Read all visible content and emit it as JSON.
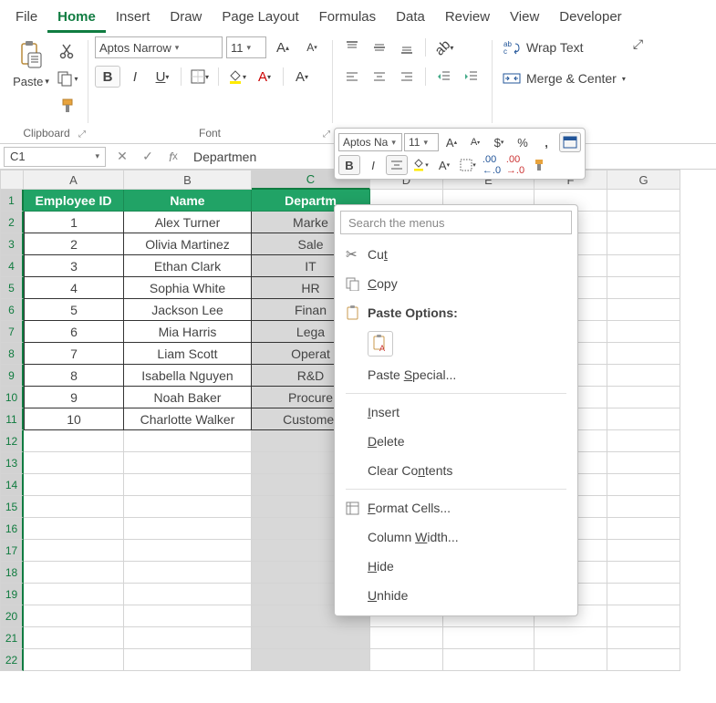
{
  "menus": [
    "File",
    "Home",
    "Insert",
    "Draw",
    "Page Layout",
    "Formulas",
    "Data",
    "Review",
    "View",
    "Developer"
  ],
  "active_menu": "Home",
  "ribbon": {
    "clipboard_label": "Clipboard",
    "paste_label": "Paste",
    "font_label": "Font",
    "font_name": "Aptos Narrow",
    "font_size": "11",
    "wrap_label": "Wrap Text",
    "merge_label": "Merge & Center"
  },
  "mini": {
    "font_name": "Aptos Na",
    "font_size": "11"
  },
  "namebox": "C1",
  "formula": "Departmen",
  "columns": [
    "A",
    "B",
    "C",
    "D",
    "E",
    "F",
    "G"
  ],
  "headers": [
    "Employee ID",
    "Name",
    "Departm"
  ],
  "rows": [
    {
      "n": "1",
      "id": "1",
      "name": "Alex Turner",
      "dept": "Marke"
    },
    {
      "n": "2",
      "id": "2",
      "name": "Olivia Martinez",
      "dept": "Sale"
    },
    {
      "n": "3",
      "id": "3",
      "name": "Ethan Clark",
      "dept": "IT"
    },
    {
      "n": "4",
      "id": "4",
      "name": "Sophia White",
      "dept": "HR"
    },
    {
      "n": "5",
      "id": "5",
      "name": "Jackson Lee",
      "dept": "Finan"
    },
    {
      "n": "6",
      "id": "6",
      "name": "Mia Harris",
      "dept": "Lega"
    },
    {
      "n": "7",
      "id": "7",
      "name": "Liam Scott",
      "dept": "Operat"
    },
    {
      "n": "8",
      "id": "8",
      "name": "Isabella Nguyen",
      "dept": "R&D"
    },
    {
      "n": "9",
      "id": "9",
      "name": "Noah Baker",
      "dept": "Procure"
    },
    {
      "n": "10",
      "id": "10",
      "name": "Charlotte Walker",
      "dept": "Customer"
    }
  ],
  "empty_rows": [
    "12",
    "13",
    "14",
    "15",
    "16",
    "17",
    "18",
    "19",
    "20",
    "21",
    "22"
  ],
  "ctx": {
    "search_placeholder": "Search the menus",
    "cut": "Cu<u>t</u>",
    "copy": "<u>C</u>opy",
    "paste_opts": "Paste Options:",
    "paste_special": "Paste <u>S</u>pecial...",
    "insert": "<u>I</u>nsert",
    "delete": "<u>D</u>elete",
    "clear": "Clear Co<u>n</u>tents",
    "format": "<u>F</u>ormat Cells...",
    "colwidth": "Column <u>W</u>idth...",
    "hide": "<u>H</u>ide",
    "unhide": "<u>U</u>nhide"
  }
}
